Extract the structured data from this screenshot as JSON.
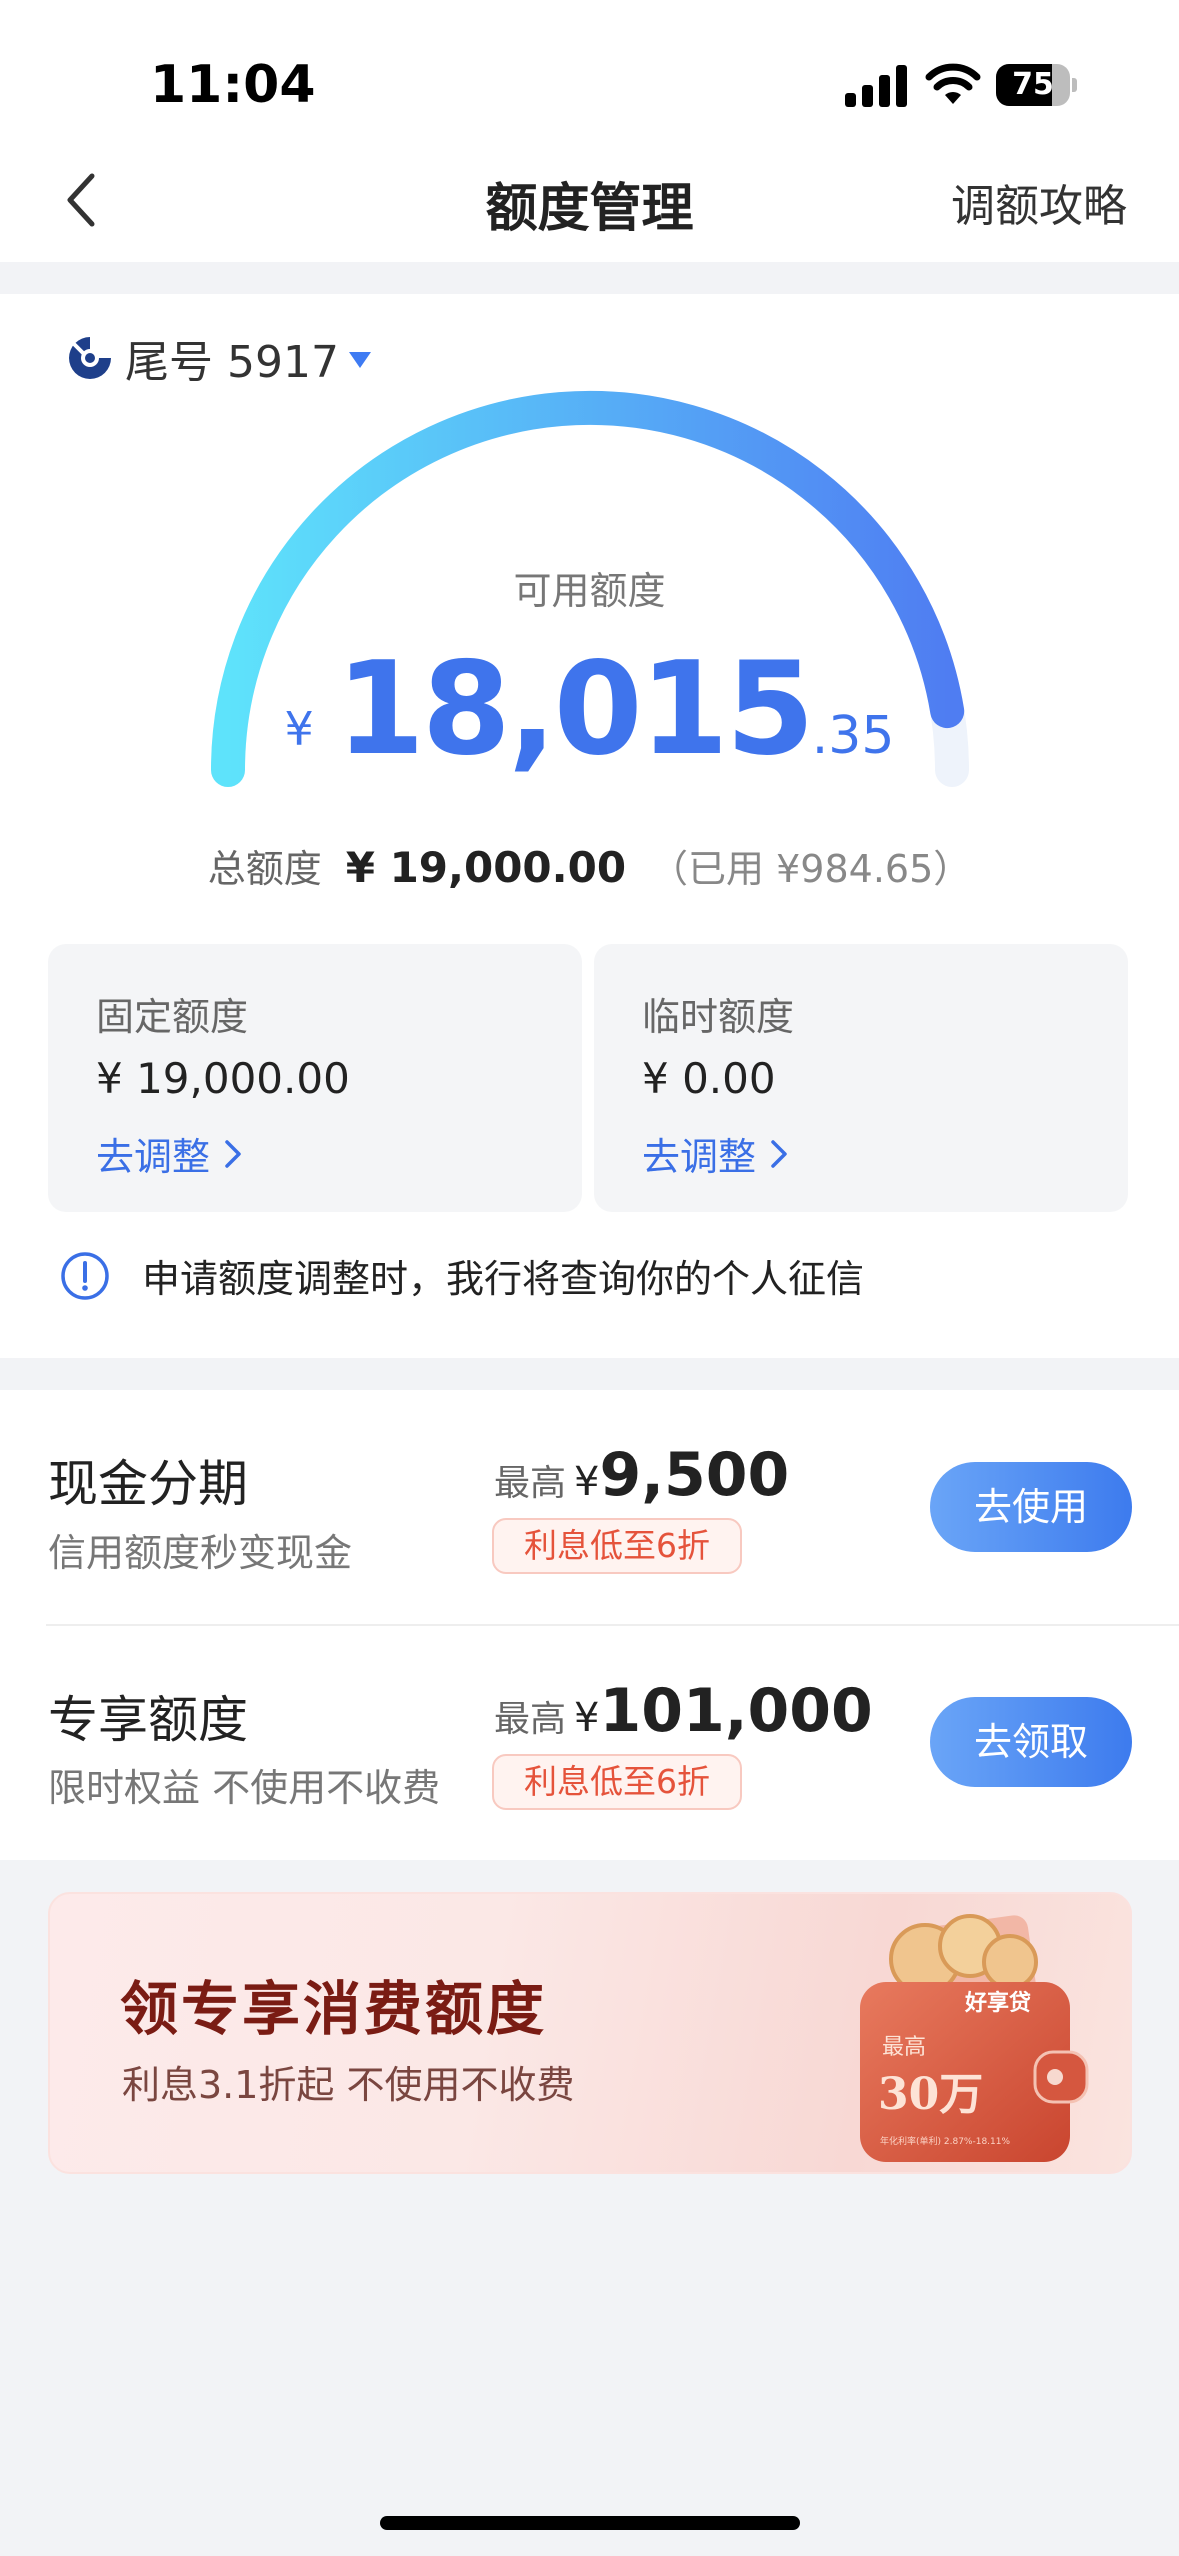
{
  "status_bar": {
    "time": "11:04",
    "battery": "75",
    "battery_level": 0.75
  },
  "header": {
    "title": "额度管理",
    "guide": "调额攻略"
  },
  "card_selector": {
    "label": "尾号 5917"
  },
  "gauge": {
    "label": "可用额度",
    "currency": "¥",
    "amount_int": "18,015",
    "amount_dec": ".35",
    "fill_ratio": 0.948,
    "gradient_colors": [
      "#5ee3fb",
      "#4f7df2"
    ]
  },
  "totals": {
    "label": "总额度",
    "total": "¥ 19,000.00",
    "used": "（已用 ¥984.65）"
  },
  "fixed": {
    "label": "固定额度",
    "value": "¥ 19,000.00",
    "action": "去调整"
  },
  "temp": {
    "label": "临时额度",
    "value": "¥ 0.00",
    "action": "去调整"
  },
  "notice": {
    "text": "申请额度调整时，我行将查询你的个人征信"
  },
  "products": [
    {
      "title": "现金分期",
      "subtitle": "信用额度秒变现金",
      "max_prefix": "最高",
      "currency": "¥",
      "max_value": "9,500",
      "tag": "利息低至6折",
      "button": "去使用"
    },
    {
      "title": "专享额度",
      "subtitle": "限时权益 不使用不收费",
      "max_prefix": "最高",
      "currency": "¥",
      "max_value": "101,000",
      "tag": "利息低至6折",
      "button": "去领取"
    }
  ],
  "banner": {
    "title": "领专享消费额度",
    "subtitle": "利息3.1折起 不使用不收费",
    "wallet_brand": "好享贷",
    "wallet_top": "最高",
    "wallet_amount": "30万",
    "wallet_note": "年化利率(单利) 2.87%-18.11%"
  },
  "colors": {
    "accent": "#3f74ec",
    "tag_red": "#e5533b",
    "banner_title": "#7a1c14"
  }
}
